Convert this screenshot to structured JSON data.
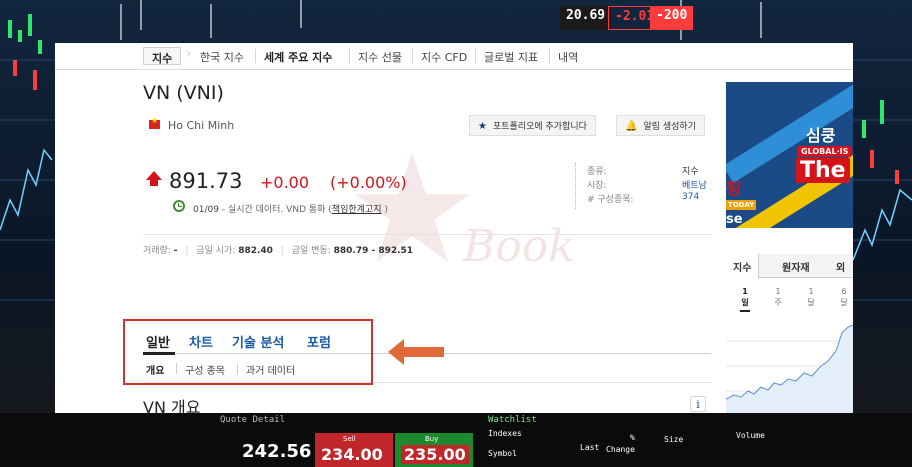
{
  "background": {
    "tickers": [
      "20.69",
      "-2.01",
      "-200"
    ],
    "header_cells": [
      "Watchlist",
      "Indexes",
      "Symbol",
      "Last",
      "%",
      "Change",
      "Size",
      "Volume"
    ],
    "quote_detail": "Quote Detail",
    "quote_price": "242.56",
    "sell": {
      "label": "Sell",
      "value": "234.00"
    },
    "buy": {
      "label": "Buy",
      "value": "235.00"
    }
  },
  "topnav": {
    "tabs": [
      "지수",
      "한국 지수",
      "세계 주요 지수",
      "지수 선물",
      "지수 CFD",
      "글로벌 지표",
      "내역"
    ]
  },
  "header": {
    "title": "VN (VNI)",
    "location": "Ho Chi Minh",
    "portfolio_button": "포트폴리오에 추가합니다",
    "alert_button": "알림 생성하기"
  },
  "quote": {
    "price": "891.73",
    "change": "+0.00",
    "change_percent": "(+0.00%)",
    "realtime_date": "01/09",
    "realtime_text": "- 실시간 데이터. VND 통화 (",
    "disclaimer_link": "책임한계고지",
    "realtime_close": ")"
  },
  "info": {
    "type_label": "종류:",
    "type_value": "지수",
    "market_label": "시장:",
    "market_value": "베트남",
    "components_label": "# 구성종목:",
    "components_value": "374"
  },
  "stats": {
    "volume_label": "거래량:",
    "volume_value": "-",
    "open_label": "금일 시가:",
    "open_value": "882.40",
    "range_label": "금일 변동:",
    "range_value": "880.79 - 892.51"
  },
  "watermark": "Book",
  "tabs": [
    "일반",
    "차트",
    "기술 분석",
    "포럼"
  ],
  "subtabs": [
    "개요",
    "구성 종목",
    "과거 데이터"
  ],
  "section_title": "VN 개요",
  "info_icon": "i",
  "right_column": {
    "ad": {
      "line1": "심쿵",
      "line2": "GLOBAL·IS",
      "line3": "The",
      "line4": "핑",
      "line5": "TODAY",
      "line6": "se"
    },
    "tabs": [
      "지수",
      "원자재",
      "외"
    ],
    "periods": [
      {
        "num": "1",
        "unit": "일"
      },
      {
        "num": "1",
        "unit": "주"
      },
      {
        "num": "1",
        "unit": "달"
      },
      {
        "num": "6",
        "unit": "달"
      }
    ]
  },
  "colors": {
    "up": "#d4141a",
    "link": "#1a5aa6",
    "highlight_box": "#d0312d",
    "arrow": "#e06a3a"
  }
}
